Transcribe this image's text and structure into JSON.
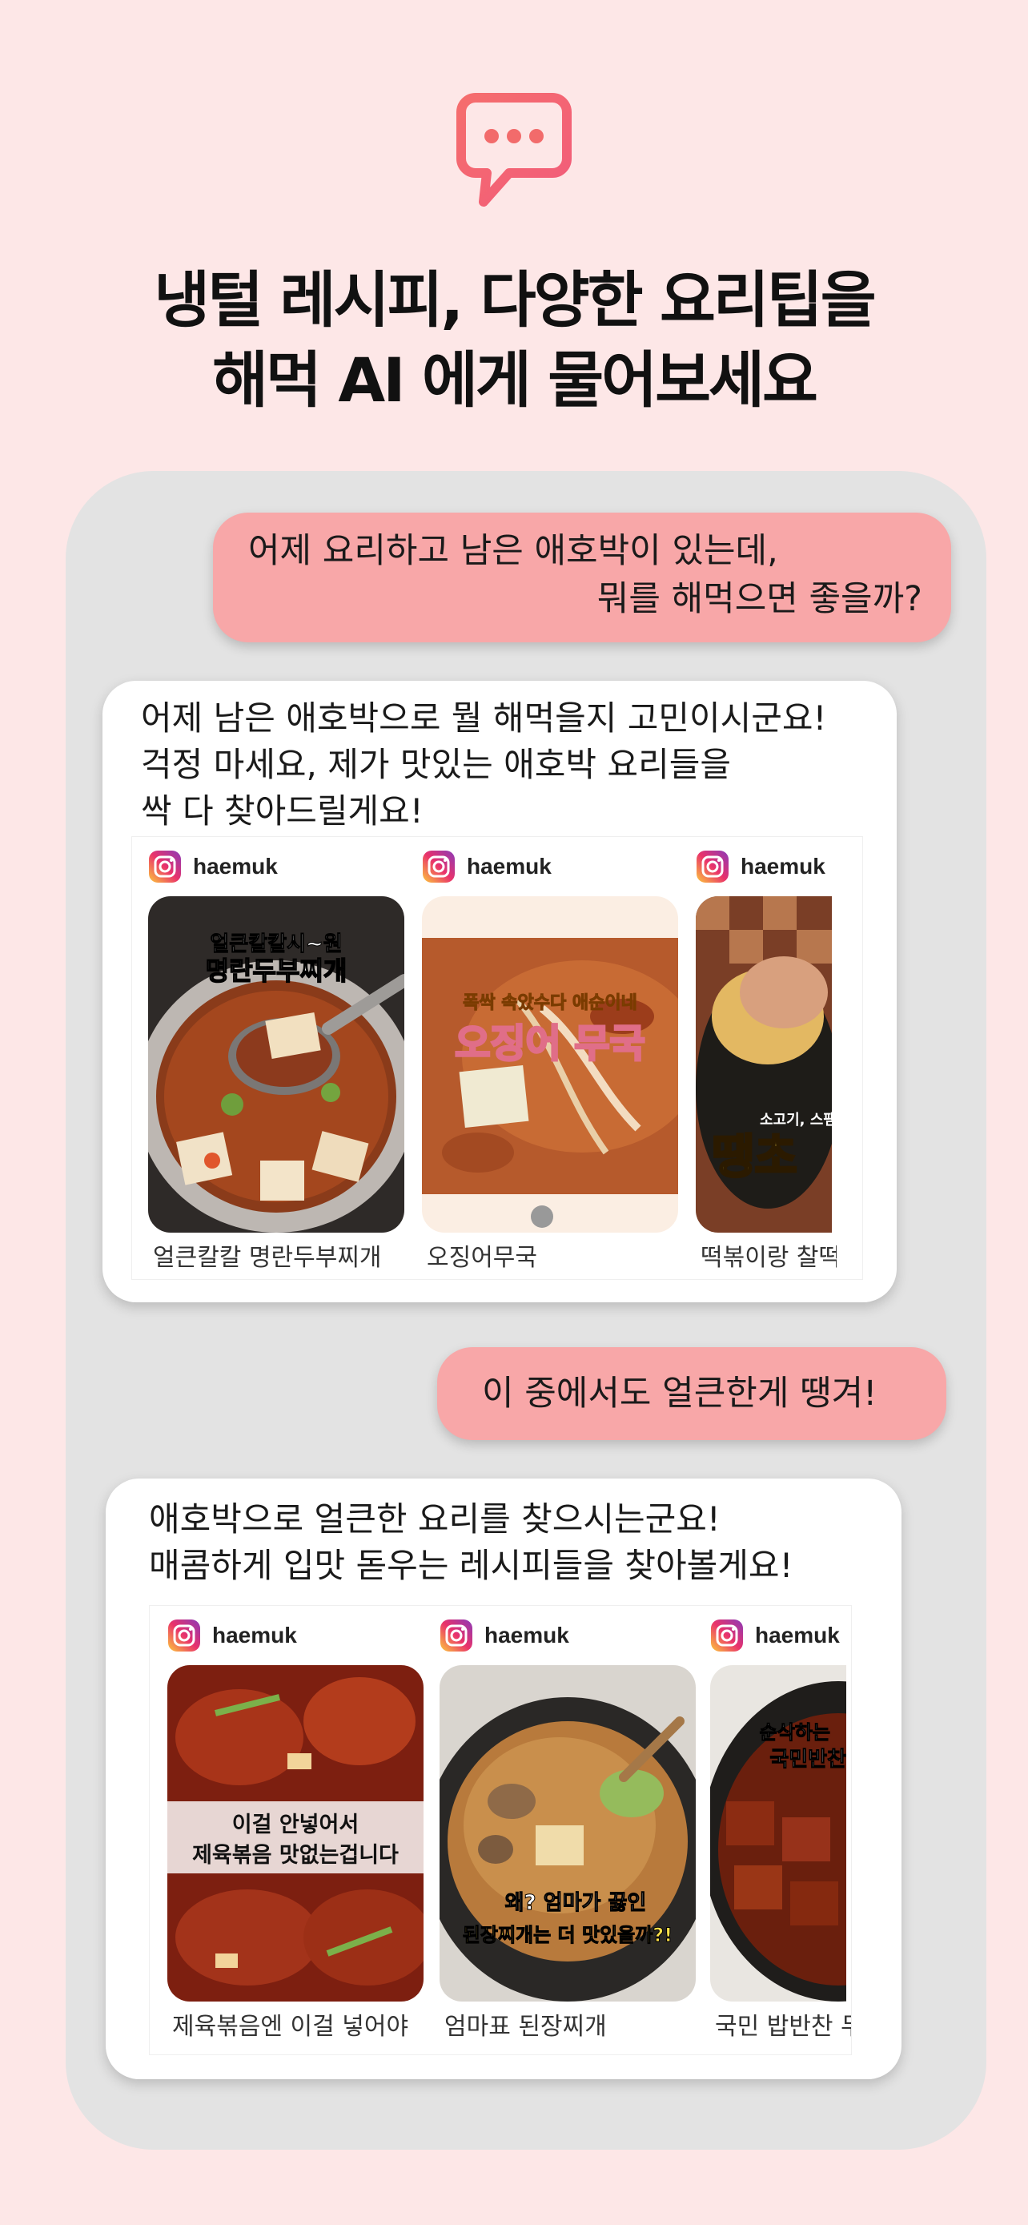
{
  "headline": {
    "line1": "냉털 레시피, 다양한 요리팁을",
    "line2": "해먹 AI 에게 물어보세요"
  },
  "colors": {
    "background": "#fde7e7",
    "panel": "#e3e3e3",
    "user_bubble": "#f8a7a8",
    "accent": "#f26b6b"
  },
  "icons": {
    "hero": "chat-bubble-dots-icon",
    "account": "instagram-icon"
  },
  "conversation": [
    {
      "role": "user",
      "lines": [
        "어제 요리하고 남은 애호박이 있는데,",
        "뭐를 해먹으면 좋을까?"
      ]
    },
    {
      "role": "bot",
      "lines": [
        "어제 남은 애호박으로 뭘 해먹을지 고민이시군요!",
        "걱정 마세요, 제가 맛있는 애호박 요리들을",
        "싹 다 찾아드릴게요!"
      ],
      "cards": [
        {
          "account": "haemuk",
          "caption": "얼큰칼칼 명란두부찌개",
          "overlay": [
            "얼큰칼칼시~원",
            "명란두부찌개"
          ]
        },
        {
          "account": "haemuk",
          "caption": "오징어무국",
          "overlay": [
            "폭싹 속았수다 애순이네",
            "오징어 무국"
          ]
        },
        {
          "account": "haemuk",
          "caption": "떡볶이랑 찰떡",
          "overlay": [
            "소고기, 스팸보다",
            "땡초"
          ]
        }
      ]
    },
    {
      "role": "user",
      "lines": [
        "이 중에서도 얼큰한게 땡겨!"
      ]
    },
    {
      "role": "bot",
      "lines": [
        "애호박으로 얼큰한 요리를 찾으시는군요!",
        "매콤하게 입맛 돋우는 레시피들을 찾아볼게요!"
      ],
      "cards": [
        {
          "account": "haemuk",
          "caption": "제육볶음엔 이걸 넣어야",
          "overlay": [
            "이걸 안넣어서",
            "제육볶음 맛없는겁니다"
          ]
        },
        {
          "account": "haemuk",
          "caption": "엄마표 된장찌개",
          "overlay": [
            "왜? 엄마가 끓인",
            "된장찌개는 더 맛있을까?!"
          ]
        },
        {
          "account": "haemuk",
          "caption": "국민 밥반찬 두부조림",
          "overlay": [
            "순삭하는",
            "국민반찬"
          ]
        }
      ]
    }
  ]
}
